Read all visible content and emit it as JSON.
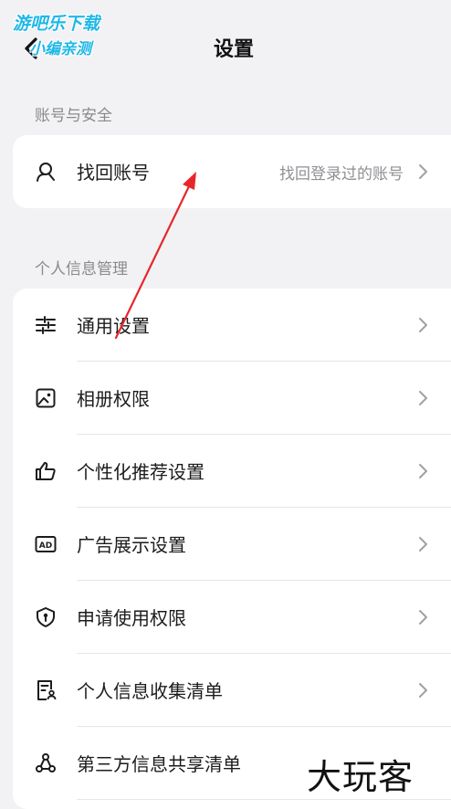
{
  "header": {
    "title": "设置",
    "watermark_line1": "游吧乐下载",
    "watermark_line2": "小编亲测"
  },
  "sections": [
    {
      "label": "账号与安全",
      "items": [
        {
          "label": "找回账号",
          "value": "找回登录过的账号",
          "icon": "user-search-icon"
        }
      ]
    },
    {
      "label": "个人信息管理",
      "items": [
        {
          "label": "通用设置",
          "icon": "sliders-icon"
        },
        {
          "label": "相册权限",
          "icon": "image-icon"
        },
        {
          "label": "个性化推荐设置",
          "icon": "thumbs-up-icon"
        },
        {
          "label": "广告展示设置",
          "icon": "ad-icon"
        },
        {
          "label": "申请使用权限",
          "icon": "shield-icon"
        },
        {
          "label": "个人信息收集清单",
          "icon": "document-person-icon"
        },
        {
          "label": "第三方信息共享清单",
          "icon": "share-icon"
        }
      ]
    }
  ],
  "watermark_bottom": "大玩客",
  "annotation_color": "#e8262a",
  "accent_watermark": "#1fb8e6"
}
